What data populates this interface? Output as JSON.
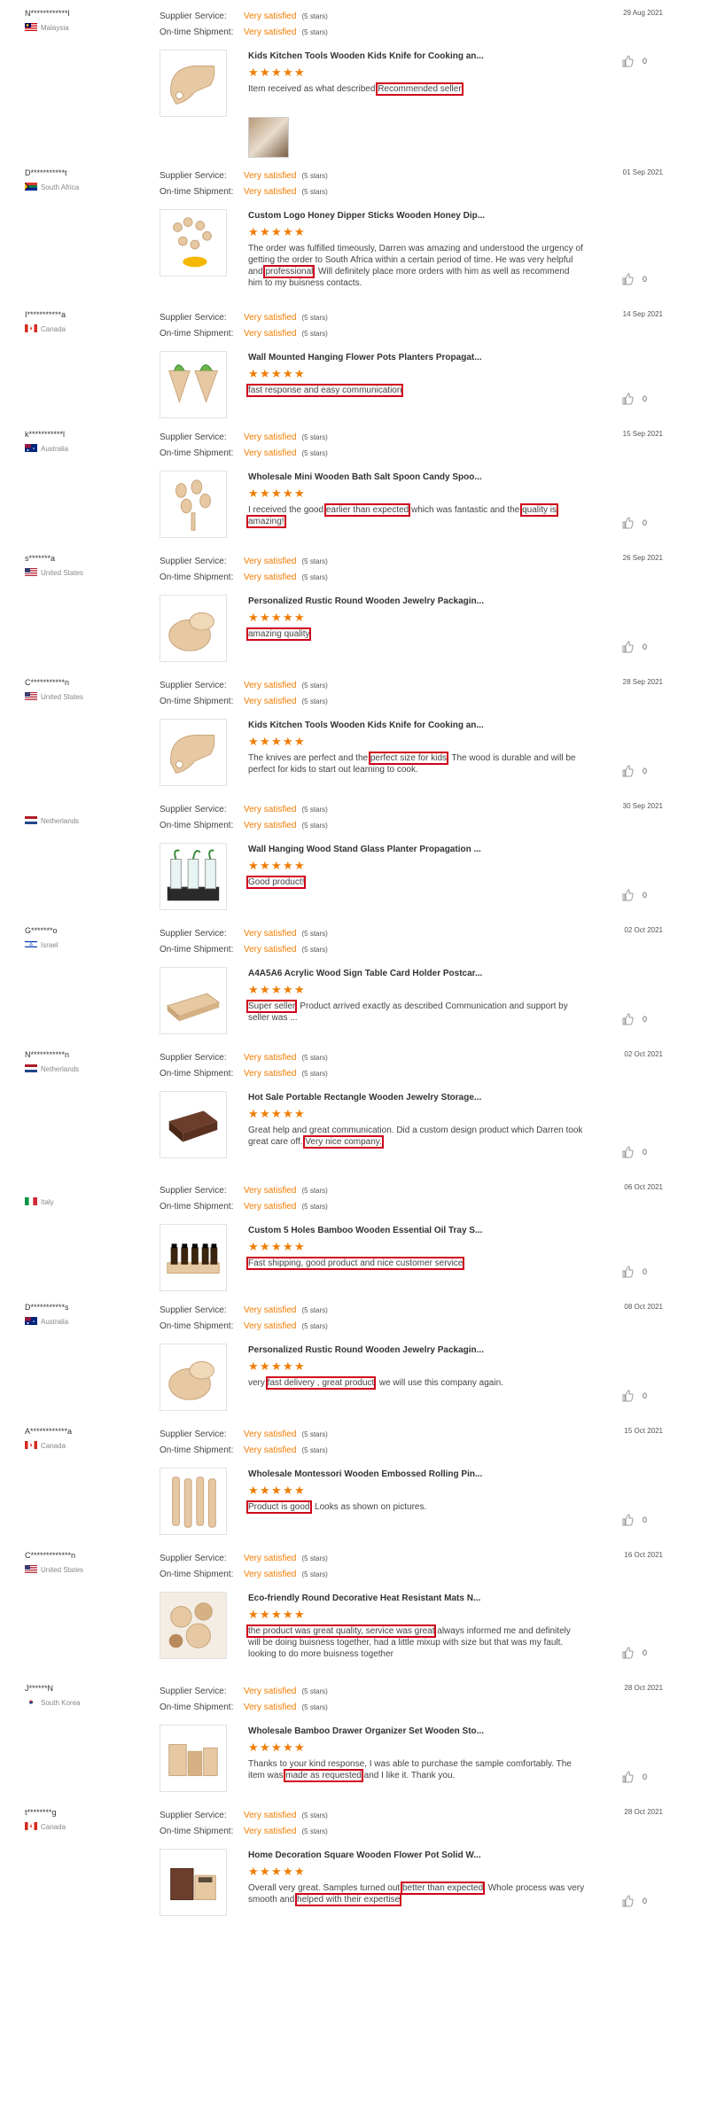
{
  "labels": {
    "supplier_service": "Supplier Service:",
    "ontime_shipment": "On-time Shipment:"
  },
  "colors": {
    "accent": "#f07c00",
    "highlight": "#d0021b"
  },
  "reviews": [
    {
      "user": "N************l",
      "country": "Malaysia",
      "flag": "MY",
      "supplier": "Very satisfied",
      "supplier_stars": "(5 stars)",
      "shipment": "Very satisfied",
      "shipment_stars": "(5 stars)",
      "date": "29 Aug 2021",
      "product": "Kids Kitchen Tools Wooden Kids Knife for Cooking an...",
      "product_icon": "wooden-knife-icon",
      "rating": 5,
      "text_parts": [
        [
          "Item received as what described ",
          false
        ],
        [
          "Recommended seller",
          true
        ]
      ],
      "likes": "0",
      "has_attachment": true
    },
    {
      "user": "D***********t",
      "country": "South Africa",
      "flag": "ZA",
      "supplier": "Very satisfied",
      "supplier_stars": "(5 stars)",
      "shipment": "Very satisfied",
      "shipment_stars": "(5 stars)",
      "date": "01 Sep 2021",
      "product": "Custom Logo Honey Dipper Sticks Wooden Honey Dip...",
      "product_icon": "honey-dipper-icon",
      "rating": 5,
      "text_parts": [
        [
          "The order was fulfilled timeously, Darren was amazing and understood the urgency of getting the order to South Africa within a certain period of time. He was very helpful and ",
          false
        ],
        [
          "professional",
          true
        ],
        [
          ". Will definitely place more orders with him as well as recommend him to my buisness contacts.",
          false
        ]
      ],
      "likes": "0"
    },
    {
      "user": "I***********a",
      "country": "Canada",
      "flag": "CA",
      "supplier": "Very satisfied",
      "supplier_stars": "(5 stars)",
      "shipment": "Very satisfied",
      "shipment_stars": "(5 stars)",
      "date": "14 Sep 2021",
      "product": "Wall Mounted Hanging Flower Pots Planters Propagat...",
      "product_icon": "hanging-planter-icon",
      "rating": 5,
      "text_parts": [
        [
          "fast response and easy communication",
          true
        ]
      ],
      "likes": "0"
    },
    {
      "user": "k***********l",
      "country": "Australia",
      "flag": "AU",
      "supplier": "Very satisfied",
      "supplier_stars": "(5 stars)",
      "shipment": "Very satisfied",
      "shipment_stars": "(5 stars)",
      "date": "15 Sep 2021",
      "product": "Wholesale Mini Wooden Bath Salt Spoon Candy Spoo...",
      "product_icon": "wooden-spoons-icon",
      "rating": 5,
      "text_parts": [
        [
          "I received the good ",
          false
        ],
        [
          "earlier than expected",
          true
        ],
        [
          " which was fantastic and the ",
          false
        ],
        [
          "quality is amazing!",
          true
        ]
      ],
      "likes": "0"
    },
    {
      "user": "s*******a",
      "country": "United States",
      "flag": "US",
      "supplier": "Very satisfied",
      "supplier_stars": "(5 stars)",
      "shipment": "Very satisfied",
      "shipment_stars": "(5 stars)",
      "date": "26 Sep 2021",
      "product": "Personalized Rustic Round Wooden Jewelry Packagin...",
      "product_icon": "round-box-icon",
      "rating": 5,
      "text_parts": [
        [
          "amazing quality",
          true
        ]
      ],
      "likes": "0"
    },
    {
      "user": "C***********n",
      "country": "United States",
      "flag": "US",
      "supplier": "Very satisfied",
      "supplier_stars": "(5 stars)",
      "shipment": "Very satisfied",
      "shipment_stars": "(5 stars)",
      "date": "28 Sep 2021",
      "product": "Kids Kitchen Tools Wooden Kids Knife for Cooking an...",
      "product_icon": "wooden-knife-icon",
      "rating": 5,
      "text_parts": [
        [
          "The knives are perfect and the ",
          false
        ],
        [
          "perfect size for kids",
          true
        ],
        [
          ". The wood is durable and will be perfect for kids to start out learning to cook.",
          false
        ]
      ],
      "likes": "0"
    },
    {
      "user": "",
      "country": "Netherlands",
      "flag": "NL",
      "supplier": "Very satisfied",
      "supplier_stars": "(5 stars)",
      "shipment": "Very satisfied",
      "shipment_stars": "(5 stars)",
      "date": "30 Sep 2021",
      "product": "Wall Hanging Wood Stand Glass Planter Propagation ...",
      "product_icon": "glass-planter-icon",
      "rating": 5,
      "text_parts": [
        [
          "Good product!",
          true
        ]
      ],
      "likes": "0"
    },
    {
      "user": "G*******o",
      "country": "Israel",
      "flag": "IL",
      "supplier": "Very satisfied",
      "supplier_stars": "(5 stars)",
      "shipment": "Very satisfied",
      "shipment_stars": "(5 stars)",
      "date": "02 Oct 2021",
      "product": "A4A5A6 Acrylic Wood Sign Table Card Holder Postcar...",
      "product_icon": "wood-block-icon",
      "rating": 5,
      "text_parts": [
        [
          "Super seller",
          true
        ],
        [
          ". Product arrived exactly as described Communication and support by seller was ...",
          false
        ]
      ],
      "likes": "0"
    },
    {
      "user": "N***********n",
      "country": "Netherlands",
      "flag": "NL",
      "supplier": "Very satisfied",
      "supplier_stars": "(5 stars)",
      "shipment": "Very satisfied",
      "shipment_stars": "(5 stars)",
      "date": "02 Oct 2021",
      "product": "Hot Sale Portable Rectangle Wooden Jewelry Storage...",
      "product_icon": "dark-box-icon",
      "rating": 5,
      "text_parts": [
        [
          "Great help and great communication. Did a custom design product which Darren took great care off. ",
          false
        ],
        [
          "Very nice company.",
          true
        ]
      ],
      "likes": "0"
    },
    {
      "user": "",
      "country": "Italy",
      "flag": "IT",
      "supplier": "Very satisfied",
      "supplier_stars": "(5 stars)",
      "shipment": "Very satisfied",
      "shipment_stars": "(5 stars)",
      "date": "06 Oct 2021",
      "product": "Custom 5 Holes Bamboo Wooden Essential Oil Tray S...",
      "product_icon": "oil-tray-icon",
      "rating": 5,
      "text_parts": [
        [
          "Fast shipping, good product and nice customer service",
          true
        ]
      ],
      "likes": "0"
    },
    {
      "user": "D***********s",
      "country": "Australia",
      "flag": "AU",
      "supplier": "Very satisfied",
      "supplier_stars": "(5 stars)",
      "shipment": "Very satisfied",
      "shipment_stars": "(5 stars)",
      "date": "08 Oct 2021",
      "product": "Personalized Rustic Round Wooden Jewelry Packagin...",
      "product_icon": "round-box-icon",
      "rating": 5,
      "text_parts": [
        [
          "very ",
          false
        ],
        [
          "fast delivery , great product",
          true
        ],
        ", we will use this company again."
      ],
      "likes": "0"
    },
    {
      "user": "A************a",
      "country": "Canada",
      "flag": "CA",
      "supplier": "Very satisfied",
      "supplier_stars": "(5 stars)",
      "shipment": "Very satisfied",
      "shipment_stars": "(5 stars)",
      "date": "15 Oct 2021",
      "product": "Wholesale Montessori Wooden Embossed Rolling Pin...",
      "product_icon": "rolling-pins-icon",
      "rating": 5,
      "text_parts": [
        [
          "Product is good",
          true
        ],
        [
          ". Looks as shown on pictures.",
          false
        ]
      ],
      "likes": "0"
    },
    {
      "user": "C*************n",
      "country": "United States",
      "flag": "US",
      "supplier": "Very satisfied",
      "supplier_stars": "(5 stars)",
      "shipment": "Very satisfied",
      "shipment_stars": "(5 stars)",
      "date": "16 Oct 2021",
      "product": "Eco-friendly Round Decorative Heat Resistant Mats N...",
      "product_icon": "round-mats-icon",
      "rating": 5,
      "text_parts": [
        [
          "the product was great quality, service was great",
          true
        ],
        [
          " always informed me and definitely will be doing buisness together, had a little mixup with size but that was my fault. looking to do more buisness together",
          false
        ]
      ],
      "likes": "0"
    },
    {
      "user": "J******N",
      "country": "South Korea",
      "flag": "KR",
      "supplier": "Very satisfied",
      "supplier_stars": "(5 stars)",
      "shipment": "Very satisfied",
      "shipment_stars": "(5 stars)",
      "date": "28 Oct 2021",
      "product": "Wholesale Bamboo Drawer Organizer Set Wooden Sto...",
      "product_icon": "drawer-organizer-icon",
      "rating": 5,
      "text_parts": [
        [
          "Thanks to your kind response, I was able to purchase the sample comfortably. The item was ",
          false
        ],
        [
          "made as requested",
          true
        ],
        [
          " and I like it. Thank you.",
          false
        ]
      ],
      "likes": "0"
    },
    {
      "user": "t********g",
      "country": "Canada",
      "flag": "CA",
      "supplier": "Very satisfied",
      "supplier_stars": "(5 stars)",
      "shipment": "Very satisfied",
      "shipment_stars": "(5 stars)",
      "date": "28 Oct 2021",
      "product": "Home Decoration Square Wooden Flower Pot Solid W...",
      "product_icon": "square-pots-icon",
      "rating": 5,
      "text_parts": [
        [
          "Overall very great. Samples turned out ",
          false
        ],
        [
          "better than expected",
          true
        ],
        [
          ". Whole process was very smooth and ",
          false
        ],
        [
          "helped with their expertise",
          true
        ],
        [
          ".",
          false
        ]
      ],
      "likes": "0"
    }
  ]
}
